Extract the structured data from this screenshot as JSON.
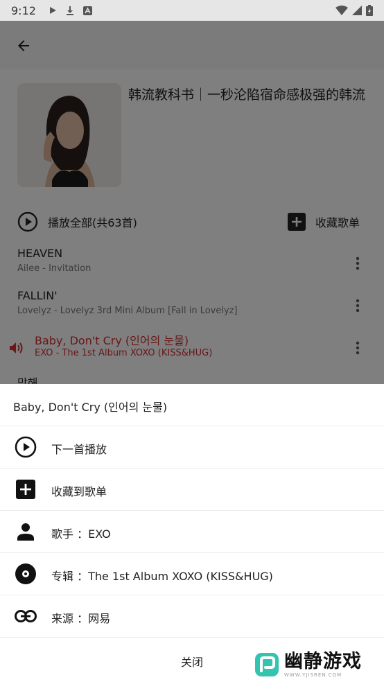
{
  "status_bar": {
    "time": "9:12"
  },
  "playlist": {
    "title": "韩流教科书｜一秒沦陷宿命感极强的韩流",
    "play_all_label": "播放全部(共63首)",
    "collect_label": "收藏歌单"
  },
  "songs": [
    {
      "title": "HEAVEN",
      "sub": "Ailee - Invitation"
    },
    {
      "title": "FALLIN'",
      "sub": "Lovelyz - Lovelyz 3rd Mini Album [Fall in Lovelyz]"
    },
    {
      "title": "Baby, Don't Cry (인어의 눈물)",
      "sub": "EXO - The 1st Album XOXO (KISS&HUG)"
    },
    {
      "title": "막해",
      "sub": ""
    }
  ],
  "sheet": {
    "title": "Baby, Don't Cry (인어의 눈물)",
    "items": [
      {
        "icon": "play-circle-icon",
        "label": "下一首播放"
      },
      {
        "icon": "add-box-icon",
        "label": "收藏到歌单"
      },
      {
        "icon": "person-icon",
        "label": "歌手 ：EXO"
      },
      {
        "icon": "album-icon",
        "label": "专辑 ：The 1st Album XOXO (KISS&HUG)"
      },
      {
        "icon": "link-icon",
        "label": "来源 ：网易"
      }
    ],
    "close_label": "关闭"
  },
  "watermark": {
    "main": "幽静游戏",
    "sub": "WWW.YJISREN.COM"
  },
  "colors": {
    "accent_playing": "#d32f2f",
    "scrim": "rgba(0,0,0,0.5)",
    "watermark_logo": "#33c4b0"
  }
}
